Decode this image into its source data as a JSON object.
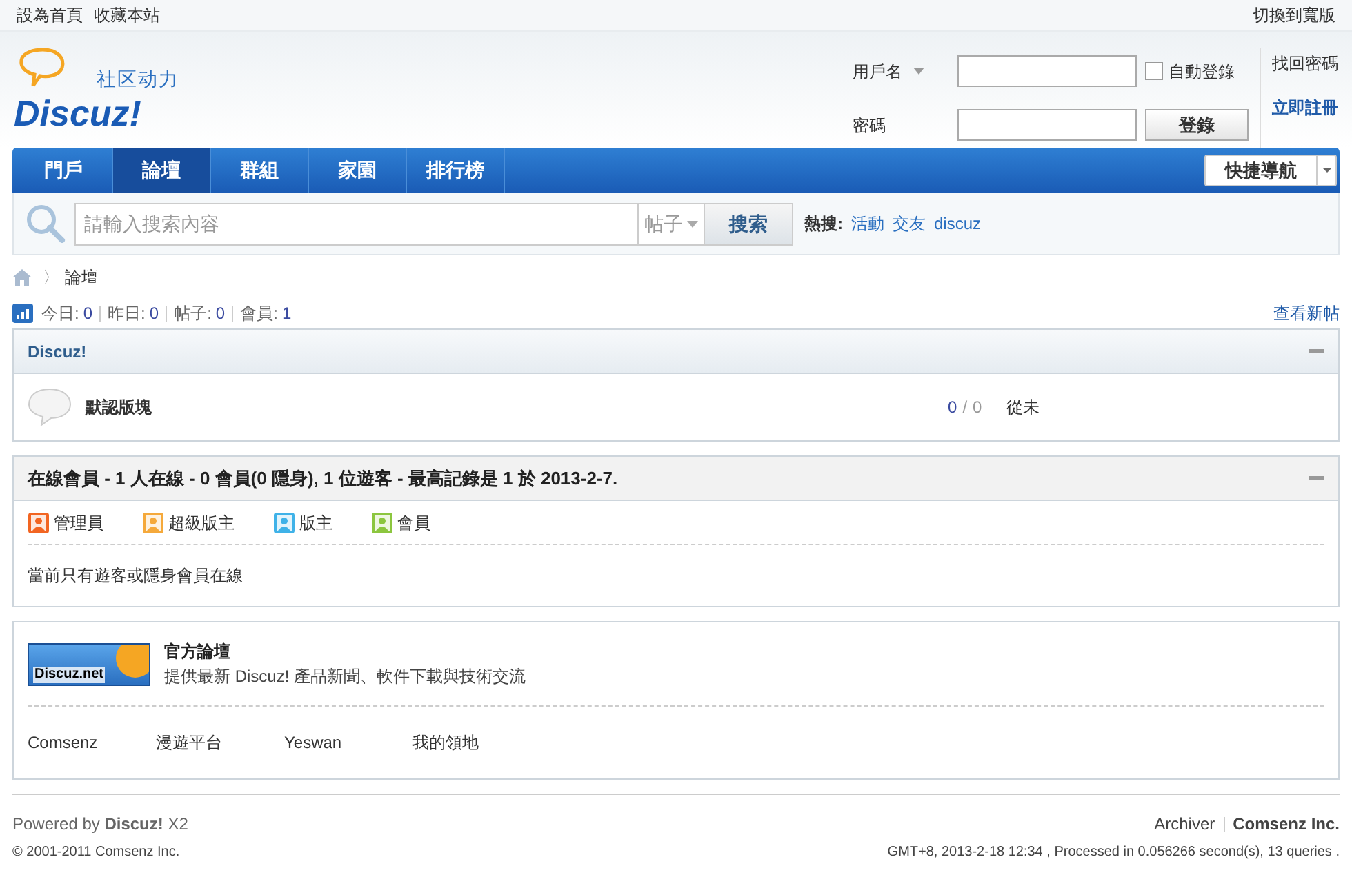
{
  "topbar": {
    "left_links": [
      "設為首頁",
      "收藏本站"
    ],
    "right_link": "切換到寬版"
  },
  "logo": {
    "wordmark": "Discuz!",
    "tagline": "社区动力"
  },
  "login": {
    "username_label": "用戶名",
    "password_label": "密碼",
    "auto_login": {
      "label": "自動登錄",
      "checked": false
    },
    "login_button": "登錄",
    "forgot": "找回密碼",
    "register": "立即註冊"
  },
  "nav": {
    "tabs": [
      {
        "label": "門戶",
        "selected": false
      },
      {
        "label": "論壇",
        "selected": true
      },
      {
        "label": "群組",
        "selected": false
      },
      {
        "label": "家園",
        "selected": false
      },
      {
        "label": "排行榜",
        "selected": false
      }
    ],
    "quick_nav": "快捷導航"
  },
  "search": {
    "placeholder": "請輸入搜索內容",
    "scope": "帖子",
    "button": "搜索",
    "hot_label": "熱搜:",
    "hot_links": [
      "活動",
      "交友",
      "discuz"
    ]
  },
  "breadcrumb": {
    "separator": "〉",
    "current": "論壇"
  },
  "stats": {
    "items": [
      {
        "label": "今日:",
        "value": "0"
      },
      {
        "label": "昨日:",
        "value": "0"
      },
      {
        "label": "帖子:",
        "value": "0"
      },
      {
        "label": "會員:",
        "value": "1"
      }
    ],
    "new_posts_link": "查看新帖"
  },
  "category": {
    "title": "Discuz!",
    "expanded": true,
    "forums": [
      {
        "name": "默認版塊",
        "threads": "0",
        "separator": "/",
        "posts": "0",
        "last_post": "從未"
      }
    ]
  },
  "online": {
    "title": "在線會員 - 1 人在線 - 0 會員(0 隱身), 1 位遊客 - 最高記錄是 1 於 2013-2-7.",
    "expanded": true,
    "legend": [
      {
        "label": "管理員",
        "color": "#f26522"
      },
      {
        "label": "超級版主",
        "color": "#f5a93b"
      },
      {
        "label": "版主",
        "color": "#3fb2e8"
      },
      {
        "label": "會員",
        "color": "#8cc63f"
      }
    ],
    "note": "當前只有遊客或隱身會員在線"
  },
  "links": {
    "featured": {
      "banner_text": "Discuz.net",
      "title": "官方論壇",
      "description": "提供最新 Discuz! 產品新聞、軟件下載與技術交流"
    },
    "text_links": [
      "Comsenz",
      "漫遊平台",
      "Yeswan",
      "我的領地"
    ]
  },
  "footer": {
    "powered": "Powered by **Discuz!** X2",
    "archiver": "Archiver",
    "company": "Comsenz Inc.",
    "copyright": "© 2001-2011 Comsenz Inc.",
    "stats_line": "GMT+8, 2013-2-18 12:34 , Processed in 0.056266 second(s), 13 queries ."
  }
}
